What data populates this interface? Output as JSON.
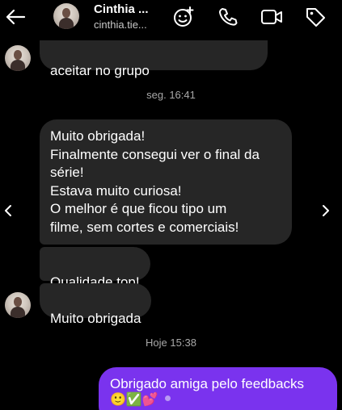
{
  "header": {
    "name": "Cinthia ...",
    "username": "cinthia.tie..."
  },
  "messages": {
    "partial_text": "aceitar no grupo",
    "timestamp_1": "seg. 16:41",
    "long_text": "Muito obrigada!\nFinalmente consegui ver o final da\nsérie!\nEstava muito curiosa!\nO melhor é que ficou tipo um\nfilme, sem cortes e comerciais!",
    "quality_text": "Qualidade top!",
    "thanks_text": "Muito obrigada",
    "timestamp_2": "Hoje 15:38",
    "outgoing_text": "Obrigado amiga pelo feedbacks",
    "outgoing_emojis": "🙂✅💕"
  },
  "colors": {
    "background": "#000000",
    "incoming_bubble": "#262626",
    "outgoing_bubble": "#7a33ee",
    "timestamp": "#a8a8a8"
  },
  "icons": [
    "back-arrow-icon",
    "add-effect-icon",
    "phone-icon",
    "video-camera-icon",
    "tag-icon",
    "chevron-left-icon",
    "chevron-right-icon"
  ]
}
